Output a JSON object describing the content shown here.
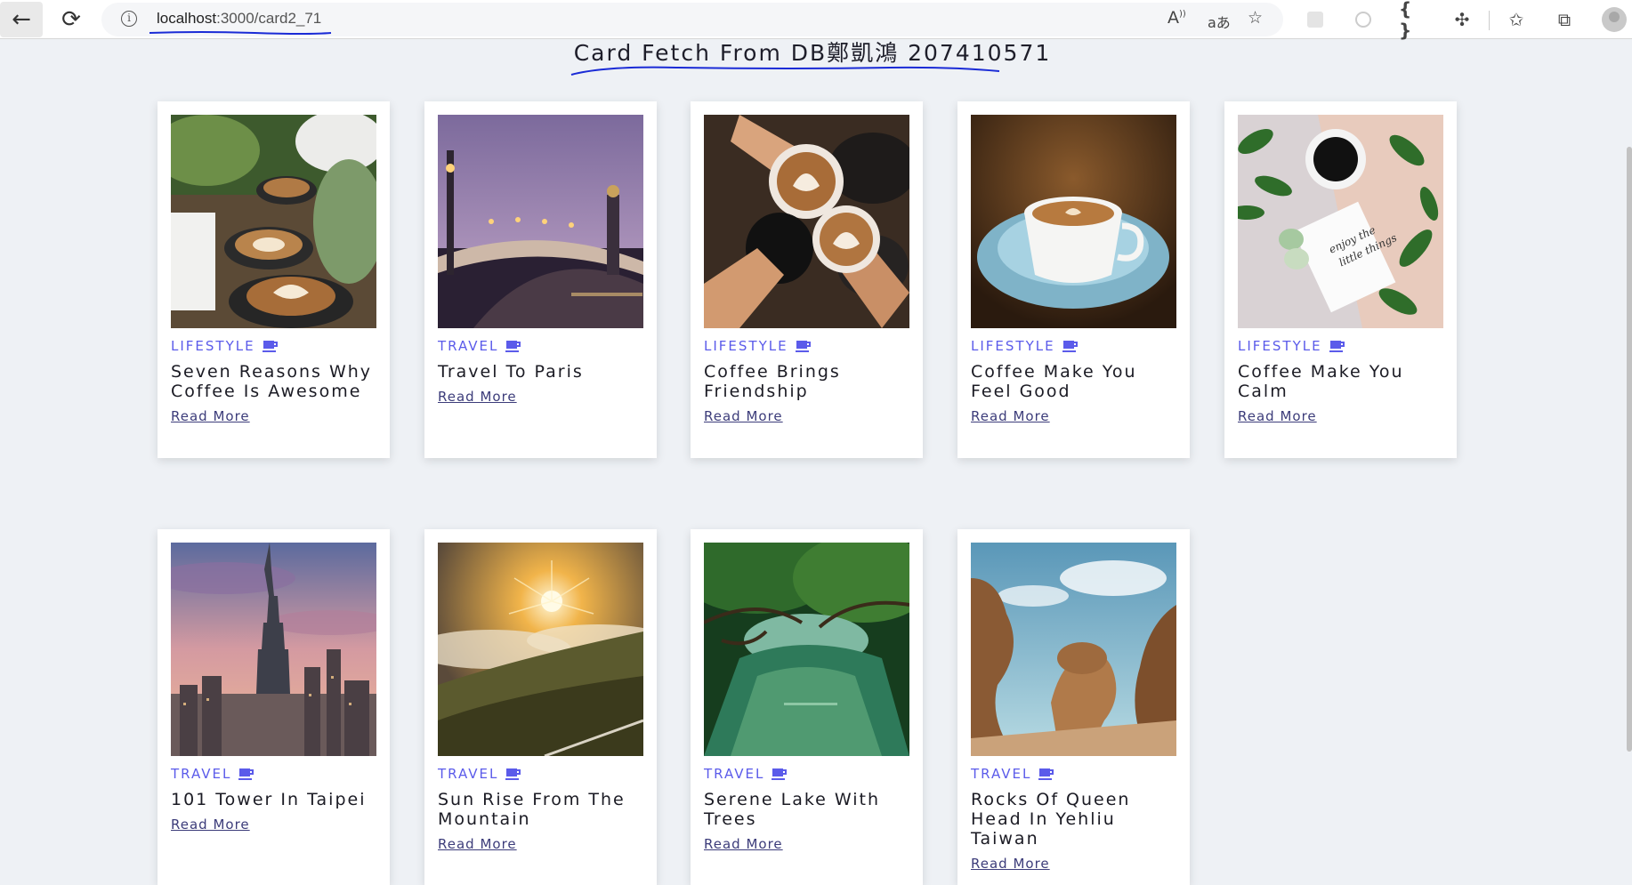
{
  "browser": {
    "url_host": "localhost",
    "url_path": ":3000/card2_71",
    "toolbar_icons": [
      "read-aloud-icon",
      "translate-icon",
      "add-favorite-icon",
      "extension-placeholder-icon",
      "extension-circle-icon",
      "json-braces-icon",
      "extensions-puzzle-icon",
      "favorites-icon",
      "collections-icon",
      "profile-icon"
    ]
  },
  "page": {
    "title": "Card Fetch From DB鄭凱鴻 207410571"
  },
  "cards": [
    {
      "category": "LIFESTYLE",
      "title": "Seven Reasons Why Coffee Is Awesome",
      "link": "Read More",
      "image": "latte-cups"
    },
    {
      "category": "TRAVEL",
      "title": "Travel To Paris",
      "link": "Read More",
      "image": "paris-bridge"
    },
    {
      "category": "LIFESTYLE",
      "title": "Coffee Brings Friendship",
      "link": "Read More",
      "image": "coffee-cheers"
    },
    {
      "category": "LIFESTYLE",
      "title": "Coffee Make You Feel Good",
      "link": "Read More",
      "image": "blue-cup"
    },
    {
      "category": "LIFESTYLE",
      "title": "Coffee Make You Calm",
      "link": "Read More",
      "image": "coffee-leaves"
    },
    {
      "category": "TRAVEL",
      "title": "101 Tower In Taipei",
      "link": "Read More",
      "image": "taipei-101"
    },
    {
      "category": "TRAVEL",
      "title": "Sun Rise From The Mountain",
      "link": "Read More",
      "image": "mountain-sunrise"
    },
    {
      "category": "TRAVEL",
      "title": "Serene Lake With Trees",
      "link": "Read More",
      "image": "green-lake"
    },
    {
      "category": "TRAVEL",
      "title": "Rocks Of Queen Head In Yehliu Taiwan",
      "link": "Read More",
      "image": "yehliu-rocks"
    }
  ],
  "colors": {
    "accent": "#5b5bea",
    "page_bg": "#eef1f5",
    "annotation_ink": "#1a2bd6"
  }
}
